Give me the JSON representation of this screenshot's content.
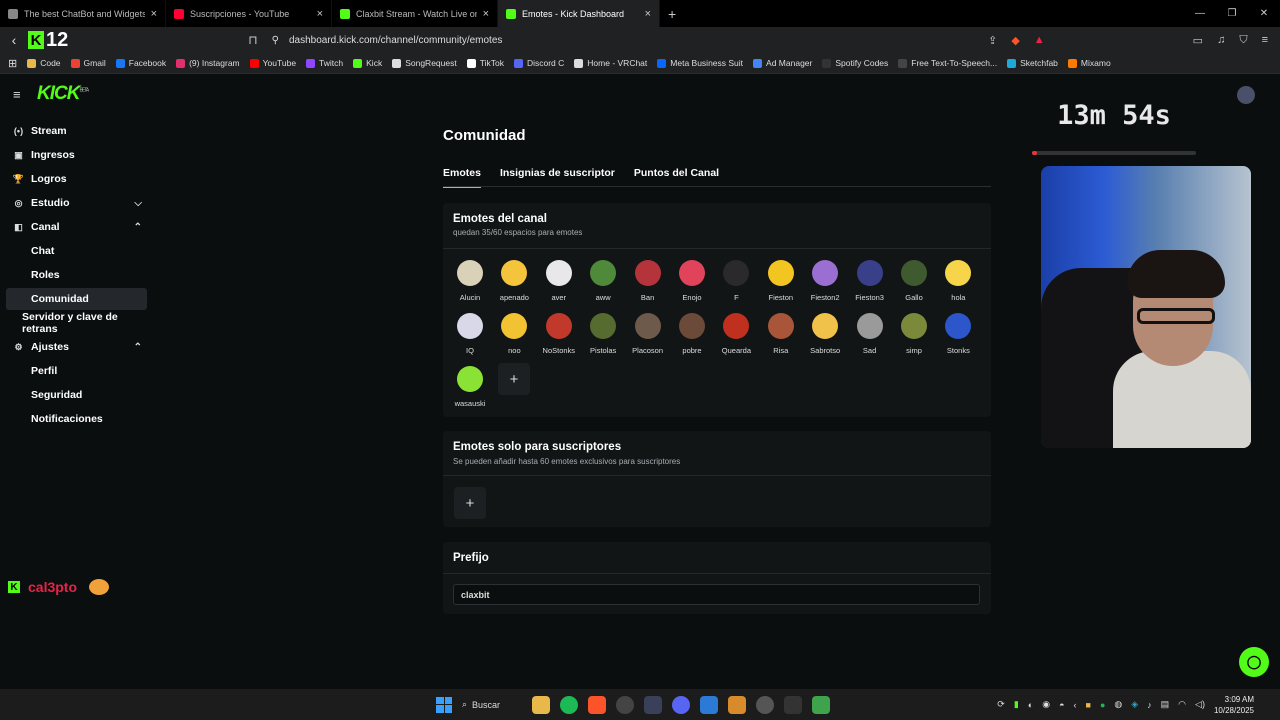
{
  "browser": {
    "tabs": [
      {
        "title": "The best ChatBot and Widgets fo",
        "color": "#888888"
      },
      {
        "title": "Suscripciones - YouTube",
        "color": "#ff0033"
      },
      {
        "title": "Claxbit Stream - Watch Live on K",
        "color": "#53fc18"
      },
      {
        "title": "Emotes - Kick Dashboard",
        "color": "#53fc18",
        "active": true
      }
    ],
    "new_tab": "+",
    "kick_badge_number": "12",
    "url": "dashboard.kick.com/channel/community/emotes",
    "bookmarks": [
      {
        "label": "Code",
        "color": "#e8b84a"
      },
      {
        "label": "Gmail",
        "color": "#ea4335"
      },
      {
        "label": "Facebook",
        "color": "#1877f2"
      },
      {
        "label": "(9) Instagram",
        "color": "#e1306c"
      },
      {
        "label": "YouTube",
        "color": "#ff0000"
      },
      {
        "label": "Twitch",
        "color": "#9146ff"
      },
      {
        "label": "Kick",
        "color": "#53fc18"
      },
      {
        "label": "SongRequest",
        "color": "#dddddd"
      },
      {
        "label": "TikTok",
        "color": "#ffffff"
      },
      {
        "label": "Discord C",
        "color": "#5865f2"
      },
      {
        "label": "Home - VRChat",
        "color": "#dddddd"
      },
      {
        "label": "Meta Business Suit",
        "color": "#0866ff"
      },
      {
        "label": "Ad Manager",
        "color": "#4285f4"
      },
      {
        "label": "Spotify Codes",
        "color": "#333333"
      },
      {
        "label": "Free Text-To-Speech...",
        "color": "#444444"
      },
      {
        "label": "Sketchfab",
        "color": "#1caad9"
      },
      {
        "label": "Mixamo",
        "color": "#ff7a00"
      }
    ]
  },
  "sidebar": {
    "logo": "KICK",
    "logo_sup": "BETA",
    "items": [
      {
        "label": "Stream",
        "icon": "broadcast-icon",
        "glyph": "(•)"
      },
      {
        "label": "Ingresos",
        "icon": "money-icon",
        "glyph": "▣"
      },
      {
        "label": "Logros",
        "icon": "trophy-icon",
        "glyph": "🏆"
      },
      {
        "label": "Estudio",
        "icon": "studio-icon",
        "glyph": "◎",
        "chevron": "⌄"
      },
      {
        "label": "Canal",
        "icon": "channel-icon",
        "glyph": "◧",
        "chevron": "⌃"
      },
      {
        "label": "Chat"
      },
      {
        "label": "Roles"
      },
      {
        "label": "Comunidad",
        "active": true
      },
      {
        "label": "Servidor y clave de retrans"
      },
      {
        "label": "Ajustes",
        "icon": "settings-icon",
        "glyph": "⚙",
        "chevron": "⌃"
      },
      {
        "label": "Perfil"
      },
      {
        "label": "Seguridad"
      },
      {
        "label": "Notificaciones"
      }
    ],
    "username": "cal3pto"
  },
  "main": {
    "title": "Comunidad",
    "tabs": [
      "Emotes",
      "Insignias de suscriptor",
      "Puntos del Canal"
    ],
    "channel_emotes": {
      "title": "Emotes del canal",
      "subtitle": "quedan 35/60 espacios para emotes",
      "emotes": [
        {
          "name": "Alucin",
          "color": "#d9d2b8"
        },
        {
          "name": "apenado",
          "color": "#f4c43c"
        },
        {
          "name": "aver",
          "color": "#e8e8e8"
        },
        {
          "name": "aww",
          "color": "#4f8a3a"
        },
        {
          "name": "Ban",
          "color": "#b5343b"
        },
        {
          "name": "Enojo",
          "color": "#e0435a"
        },
        {
          "name": "F",
          "color": "#2a2a2a"
        },
        {
          "name": "Fieston",
          "color": "#f3c521"
        },
        {
          "name": "Fieston2",
          "color": "#9a6fd1"
        },
        {
          "name": "Fieston3",
          "color": "#3a3f8a"
        },
        {
          "name": "Gallo",
          "color": "#3f5a2f"
        },
        {
          "name": "hola",
          "color": "#f7d54a"
        },
        {
          "name": "IQ",
          "color": "#d8d8e8"
        },
        {
          "name": "noo",
          "color": "#f1c232"
        },
        {
          "name": "NoStonks",
          "color": "#c0392b"
        },
        {
          "name": "Pistolas",
          "color": "#556b2f"
        },
        {
          "name": "Placoson",
          "color": "#6e5a4a"
        },
        {
          "name": "pobre",
          "color": "#6b4a3a"
        },
        {
          "name": "Quearda",
          "color": "#c0301e"
        },
        {
          "name": "Risa",
          "color": "#a8553a"
        },
        {
          "name": "Sabrotso",
          "color": "#f0c24a"
        },
        {
          "name": "Sad",
          "color": "#9a9a9a"
        },
        {
          "name": "simp",
          "color": "#7a8a3a"
        },
        {
          "name": "Stonks",
          "color": "#2c56c9"
        },
        {
          "name": "wasauski",
          "color": "#8ae234"
        }
      ],
      "add": "+"
    },
    "sub_emotes": {
      "title": "Emotes solo para suscriptores",
      "subtitle": "Se pueden añadir hasta 60 emotes exclusivos para suscriptores",
      "add": "+"
    },
    "prefix": {
      "title": "Prefijo",
      "value": "claxbit"
    }
  },
  "overlay": {
    "timer": "13m 54s",
    "timer_progress": 0.03
  },
  "taskbar": {
    "search": "Buscar",
    "time": "3:09 AM",
    "date": "10/28/2025"
  },
  "colors": {
    "accent": "#53fc18",
    "background": "#0b0e0f",
    "card": "#121516"
  }
}
